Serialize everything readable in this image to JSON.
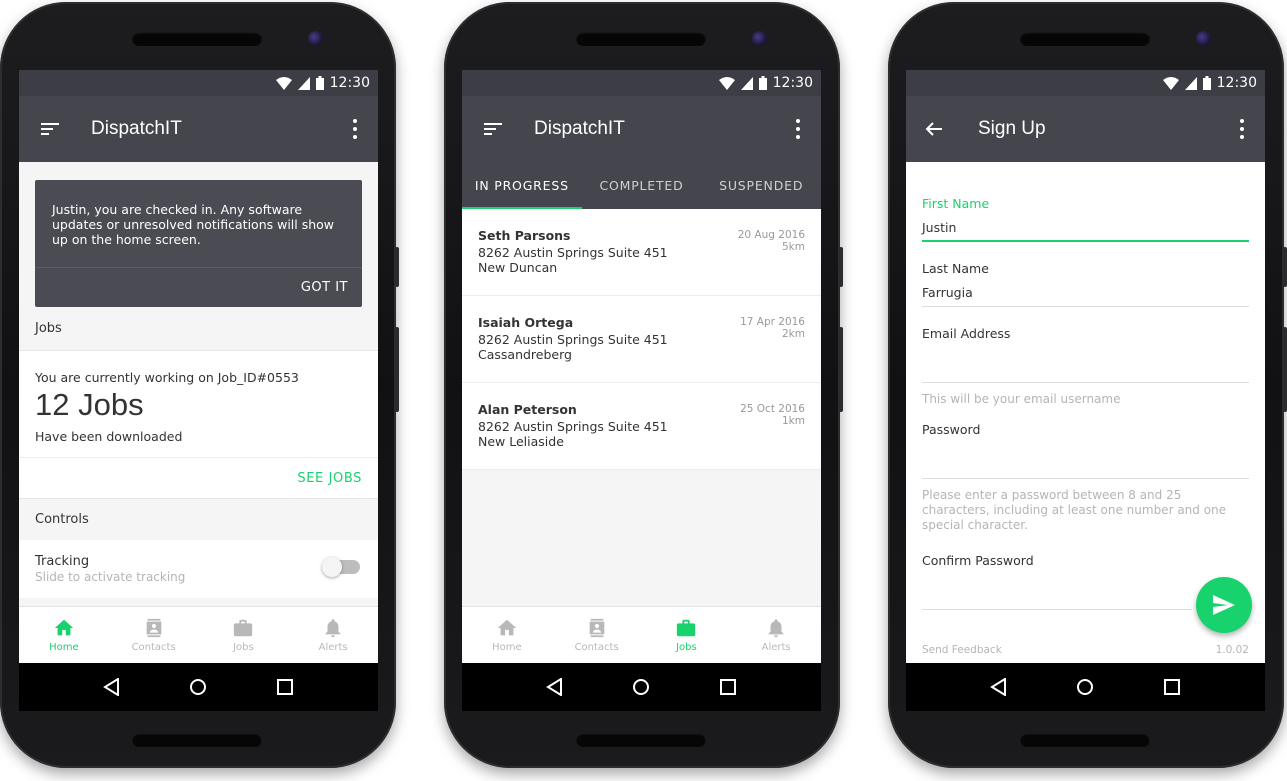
{
  "status_bar": {
    "time": "12:30"
  },
  "screens": {
    "home": {
      "title": "DispatchIT",
      "notice": {
        "message": "Justin, you are checked in. Any software updates or unresolved notifications will show up on the home screen.",
        "action": "GOT IT"
      },
      "jobs_section_label": "Jobs",
      "jobs_card": {
        "current_job": "You are currently working on Job_ID#0553",
        "count": "12 Jobs",
        "subtitle": "Have been downloaded",
        "action": "SEE JOBS"
      },
      "controls_label": "Controls",
      "tracking": {
        "label": "Tracking",
        "hint": "Slide to activate tracking",
        "enabled": false
      }
    },
    "jobs": {
      "title": "DispatchIT",
      "tabs": [
        "IN PROGRESS",
        "COMPLETED",
        "SUSPENDED"
      ],
      "active_tab": "IN PROGRESS",
      "items": [
        {
          "name": "Seth Parsons",
          "address": "8262 Austin Springs Suite 451",
          "city": "New Duncan",
          "date": "20 Aug 2016",
          "distance": "5km"
        },
        {
          "name": "Isaiah Ortega",
          "address": "8262 Austin Springs Suite 451",
          "city": "Cassandreberg",
          "date": "17 Apr 2016",
          "distance": "2km"
        },
        {
          "name": "Alan Peterson",
          "address": "8262 Austin Springs Suite 451",
          "city": "New Leliaside",
          "date": "25 Oct 2016",
          "distance": "1km"
        }
      ]
    },
    "signup": {
      "title": "Sign Up",
      "fields": {
        "first_name": {
          "label": "First Name",
          "value": "Justin"
        },
        "last_name": {
          "label": "Last Name",
          "value": "Farrugia"
        },
        "email": {
          "label": "Email Address",
          "value": "",
          "hint": "This will be your email username"
        },
        "password": {
          "label": "Password",
          "value": "",
          "hint": "Please enter a password between 8 and 25 characters, including at least one number and one special character."
        },
        "confirm_password": {
          "label": "Confirm Password",
          "value": ""
        }
      },
      "footer": {
        "feedback": "Send Feedback",
        "version": "1.0.02"
      }
    }
  },
  "bottom_nav": [
    "Home",
    "Contacts",
    "Jobs",
    "Alerts"
  ],
  "colors": {
    "accent": "#18d26e",
    "toolbar": "#45454d",
    "statusbar": "#3d3d45"
  },
  "icons": [
    "wifi-icon",
    "signal-icon",
    "battery-icon",
    "menu-icon",
    "more-icon",
    "back-arrow-icon",
    "send-icon",
    "home-icon",
    "contacts-icon",
    "jobs-icon",
    "alerts-icon",
    "nav-back-icon",
    "nav-home-icon",
    "nav-recents-icon"
  ]
}
